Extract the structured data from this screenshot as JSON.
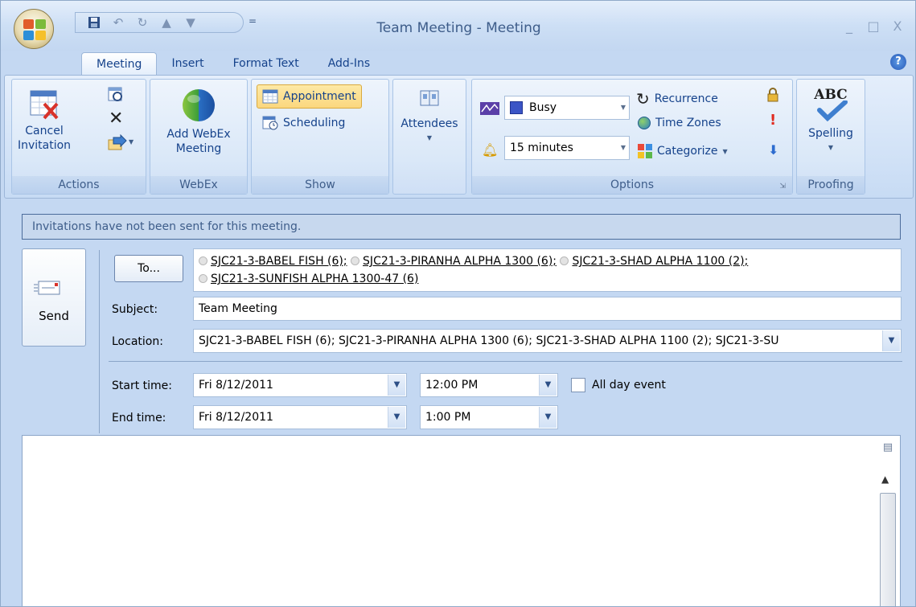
{
  "window": {
    "title": "Team Meeting - Meeting",
    "controls": {
      "minimize": "_",
      "maximize": "□",
      "close": "X"
    }
  },
  "qat": {
    "more": "="
  },
  "tabs": [
    {
      "label": "Meeting",
      "active": true
    },
    {
      "label": "Insert"
    },
    {
      "label": "Format Text"
    },
    {
      "label": "Add-Ins"
    }
  ],
  "ribbon": {
    "actions": {
      "group_label": "Actions",
      "cancel_line1": "Cancel",
      "cancel_line2": "Invitation"
    },
    "webex": {
      "group_label": "WebEx",
      "add_line1": "Add WebEx",
      "add_line2": "Meeting"
    },
    "show": {
      "group_label": "Show",
      "appointment": "Appointment",
      "scheduling": "Scheduling"
    },
    "attendees": {
      "label": "Attendees"
    },
    "options": {
      "group_label": "Options",
      "show_as": "Busy",
      "reminder": "15 minutes",
      "recurrence": "Recurrence",
      "time_zones": "Time Zones",
      "categorize": "Categorize"
    },
    "proofing": {
      "group_label": "Proofing",
      "spelling_icon_text": "ABC",
      "spelling": "Spelling"
    }
  },
  "infobar": {
    "text": "Invitations have not been sent for this meeting."
  },
  "form": {
    "send_label": "Send",
    "to_button": "To...",
    "recipients": [
      "SJC21-3-BABEL FISH (6);",
      "SJC21-3-PIRANHA ALPHA 1300 (6);",
      "SJC21-3-SHAD ALPHA 1100 (2);",
      "SJC21-3-SUNFISH ALPHA 1300-47 (6)"
    ],
    "subject_label": "Subject:",
    "subject_value": "Team Meeting",
    "location_label": "Location:",
    "location_value": "SJC21-3-BABEL FISH (6); SJC21-3-PIRANHA ALPHA 1300 (6); SJC21-3-SHAD ALPHA 1100 (2); SJC21-3-SU",
    "start_label": "Start time:",
    "start_date": "Fri 8/12/2011",
    "start_time": "12:00 PM",
    "end_label": "End time:",
    "end_date": "Fri 8/12/2011",
    "end_time": "1:00 PM",
    "all_day_label": "All day event",
    "all_day_checked": false
  },
  "colors": {
    "ribbon_text": "#15428b",
    "appointment_highlight": "#fbd77e"
  }
}
